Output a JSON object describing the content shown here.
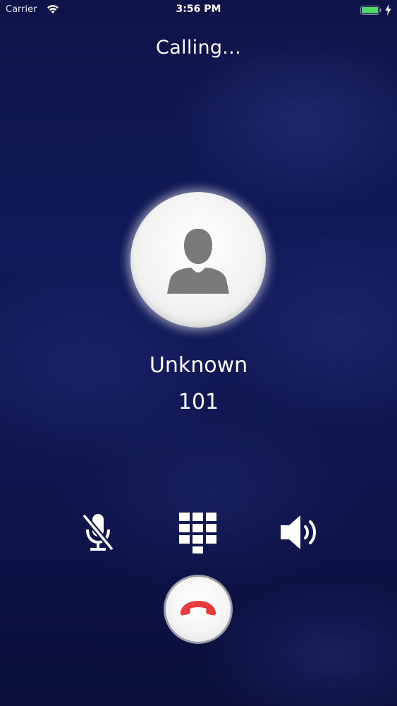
{
  "status_bar": {
    "carrier": "Carrier",
    "time": "3:56 PM",
    "wifi_icon": "wifi-icon",
    "battery_icon": "battery-icon",
    "charging_icon": "charging-bolt-icon",
    "battery_color": "#4cd964"
  },
  "call": {
    "status": "Calling...",
    "caller_name": "Unknown",
    "caller_number": "101",
    "avatar_icon": "person-icon"
  },
  "controls": {
    "mute_icon": "microphone-muted-icon",
    "keypad_icon": "keypad-icon",
    "speaker_icon": "speaker-icon",
    "end_call_icon": "hangup-phone-icon"
  },
  "colors": {
    "background": "#111a5a",
    "end_call_red": "#e83b3b",
    "text": "#ffffff"
  }
}
